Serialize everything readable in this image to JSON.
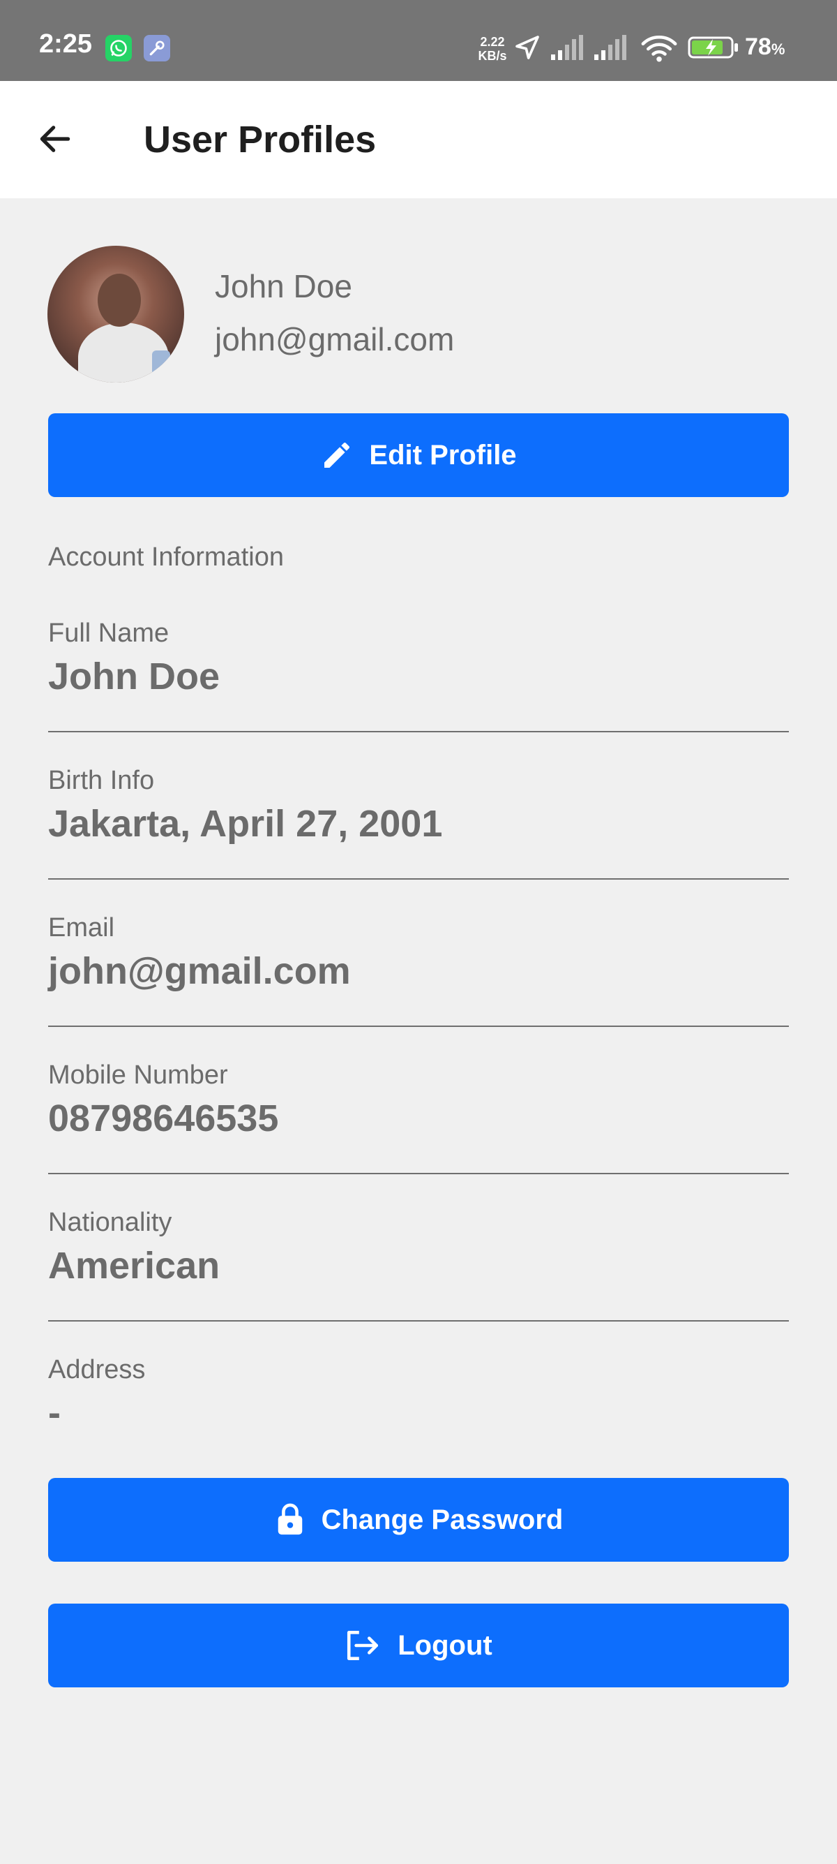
{
  "status_bar": {
    "time": "2:25",
    "speed_value": "2.22",
    "speed_unit": "KB/s",
    "battery_level": "78",
    "battery_unit": "%",
    "icons": [
      "whatsapp-icon",
      "tools-icon",
      "location-arrow-icon",
      "signal-icon",
      "signal-icon",
      "wifi-icon",
      "battery-charging-icon"
    ]
  },
  "app_bar": {
    "back_icon": "arrow-left-icon",
    "title": "User Profiles"
  },
  "profile": {
    "name": "John Doe",
    "email": "john@gmail.com"
  },
  "buttons": {
    "edit_profile": "Edit Profile",
    "change_password": "Change Password",
    "logout": "Logout"
  },
  "account": {
    "section_title": "Account Information",
    "fields": [
      {
        "label": "Full Name",
        "value": "John Doe"
      },
      {
        "label": "Birth Info",
        "value": "Jakarta, April 27, 2001"
      },
      {
        "label": "Email",
        "value": "john@gmail.com"
      },
      {
        "label": "Mobile Number",
        "value": "08798646535"
      },
      {
        "label": "Nationality",
        "value": "American"
      },
      {
        "label": "Address",
        "value": "-"
      }
    ]
  },
  "colors": {
    "primary": "#0d6efd",
    "status_bar": "#757575",
    "background": "#f0f0f0",
    "text_muted": "#6b6b6b"
  }
}
